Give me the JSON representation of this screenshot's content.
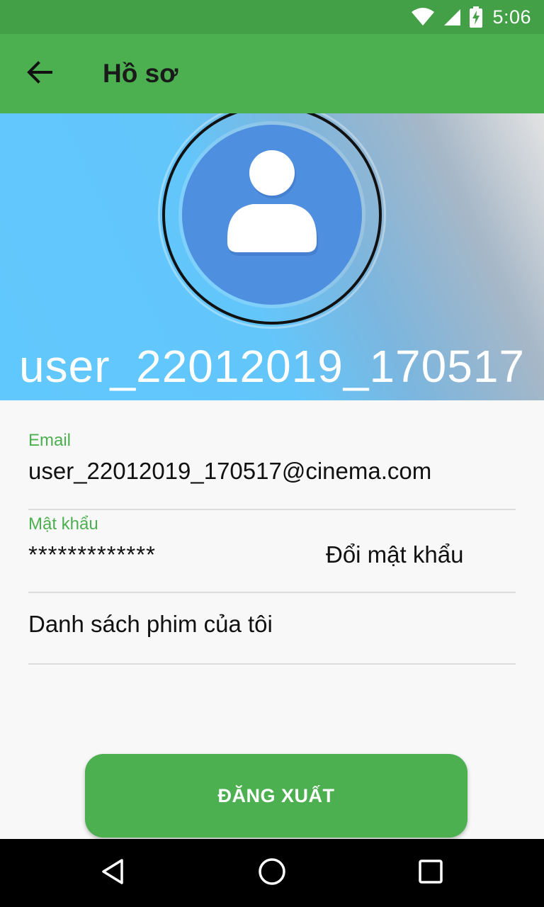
{
  "status_bar": {
    "time": "5:06",
    "icons": [
      "wifi-icon",
      "cell-signal-icon",
      "battery-charging-icon"
    ]
  },
  "app_bar": {
    "back_icon": "arrow-left-icon",
    "title": "Hồ sơ",
    "color": "#4caf50"
  },
  "profile": {
    "avatar_icon": "person-icon",
    "username": "user_22012019_170517"
  },
  "fields": {
    "email_label": "Email",
    "email_value": "user_22012019_170517@cinema.com",
    "password_label": "Mật khẩu",
    "password_value": "*************",
    "change_password": "Đổi mật khẩu",
    "movie_list": "Danh sách phim của tôi"
  },
  "actions": {
    "logout": "ĐĂNG XUẤT"
  },
  "nav_bar": {
    "icons": [
      "nav-back-icon",
      "nav-home-icon",
      "nav-recents-icon"
    ]
  },
  "colors": {
    "primary": "#4caf50",
    "primary_dark": "#43a047",
    "accent_label": "#4caf50"
  }
}
